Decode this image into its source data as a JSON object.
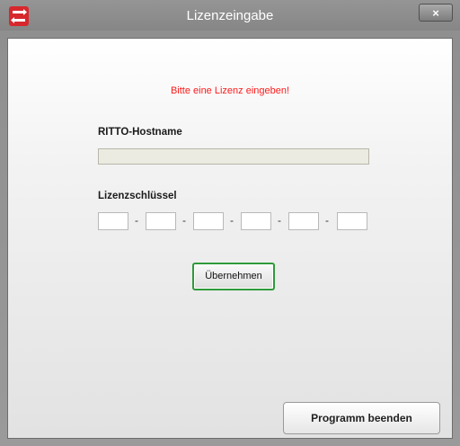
{
  "window": {
    "title": "Lizenzeingabe",
    "close_label": "×",
    "app_icon": "ritto-logo-icon"
  },
  "dialog": {
    "message": "Bitte eine Lizenz eingeben!",
    "hostname_label": "RITTO-Hostname",
    "hostname_value": "",
    "license_label": "Lizenzschlüssel",
    "license_key_fields": [
      "",
      "",
      "",
      "",
      "",
      ""
    ],
    "separator": "-",
    "apply_button": "Übernehmen",
    "quit_button": "Programm beenden"
  },
  "colors": {
    "message": "#ff1a1a",
    "apply_border": "#2f9a3a",
    "icon": "#d7282d"
  }
}
